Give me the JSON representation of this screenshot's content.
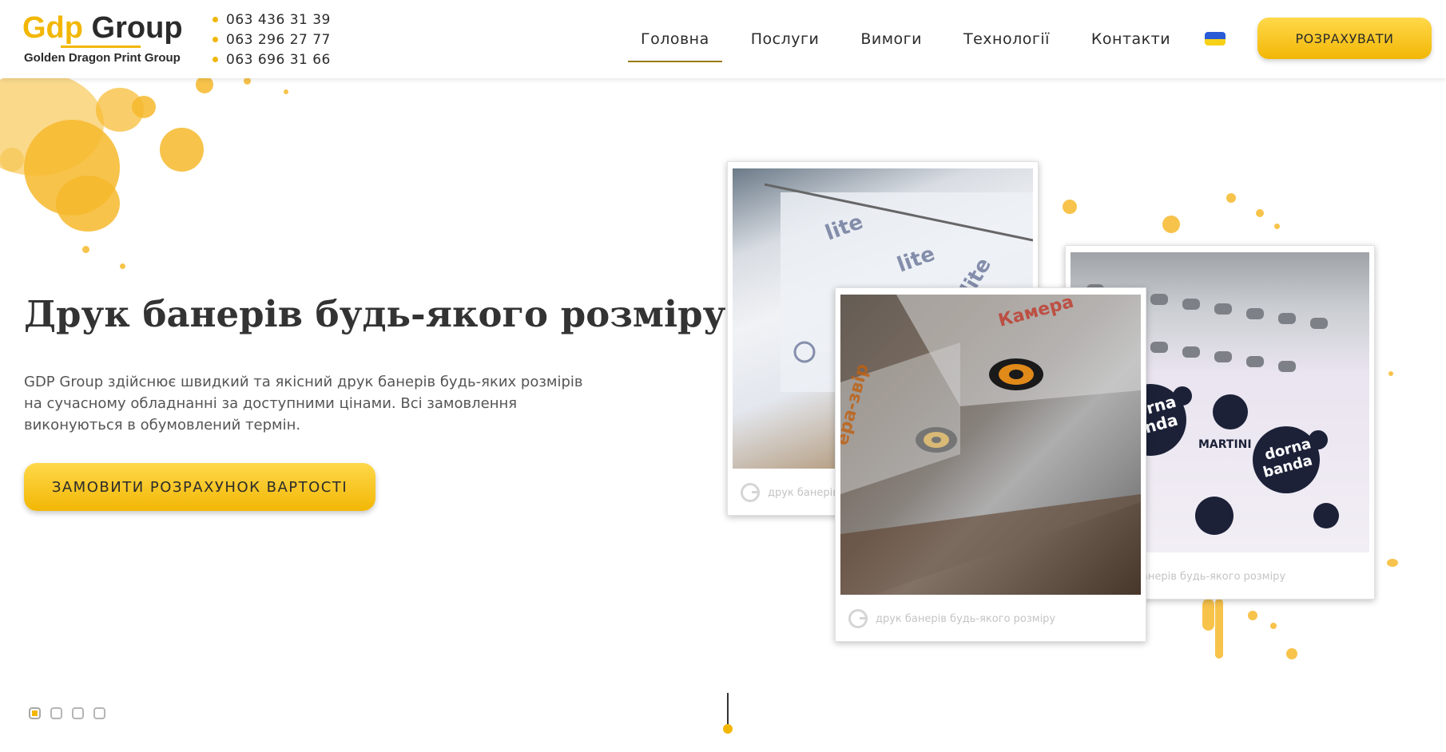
{
  "header": {
    "logo": {
      "brand": "Group",
      "brand_prefix": "Gdp",
      "tagline": "Golden Dragon Print Group"
    },
    "phones": [
      "063 436 31 39",
      "063 296 27 77",
      "063 696 31 66"
    ],
    "nav": [
      {
        "label": "Головна",
        "active": true
      },
      {
        "label": "Послуги",
        "active": false
      },
      {
        "label": "Вимоги",
        "active": false
      },
      {
        "label": "Технології",
        "active": false
      },
      {
        "label": "Контакти",
        "active": false
      }
    ],
    "language_icon": "ukraine-flag-icon",
    "cta_label": "РОЗРАХУВАТИ"
  },
  "hero": {
    "title": "Друк банерів будь-якого розміру",
    "description": "GDP Group здійснює швидкий та якісний друк банерів будь-яких розмірів на сучасному обладнанні за доступними цінами. Всі замовлення виконуються в обумовлений термін.",
    "cta_label": "ЗАМОВИТИ РОЗРАХУНОК ВАРТОСТІ",
    "cards": [
      {
        "caption": "друк банерів будь-якого розміру"
      },
      {
        "caption": "друк банерів будь-якого розміру"
      },
      {
        "caption": "друк банерів будь-якого розміру"
      }
    ]
  },
  "slider": {
    "active_index": 0,
    "count": 4
  },
  "colors": {
    "accent": "#f2b705",
    "text": "#333333",
    "muted": "#555555"
  }
}
